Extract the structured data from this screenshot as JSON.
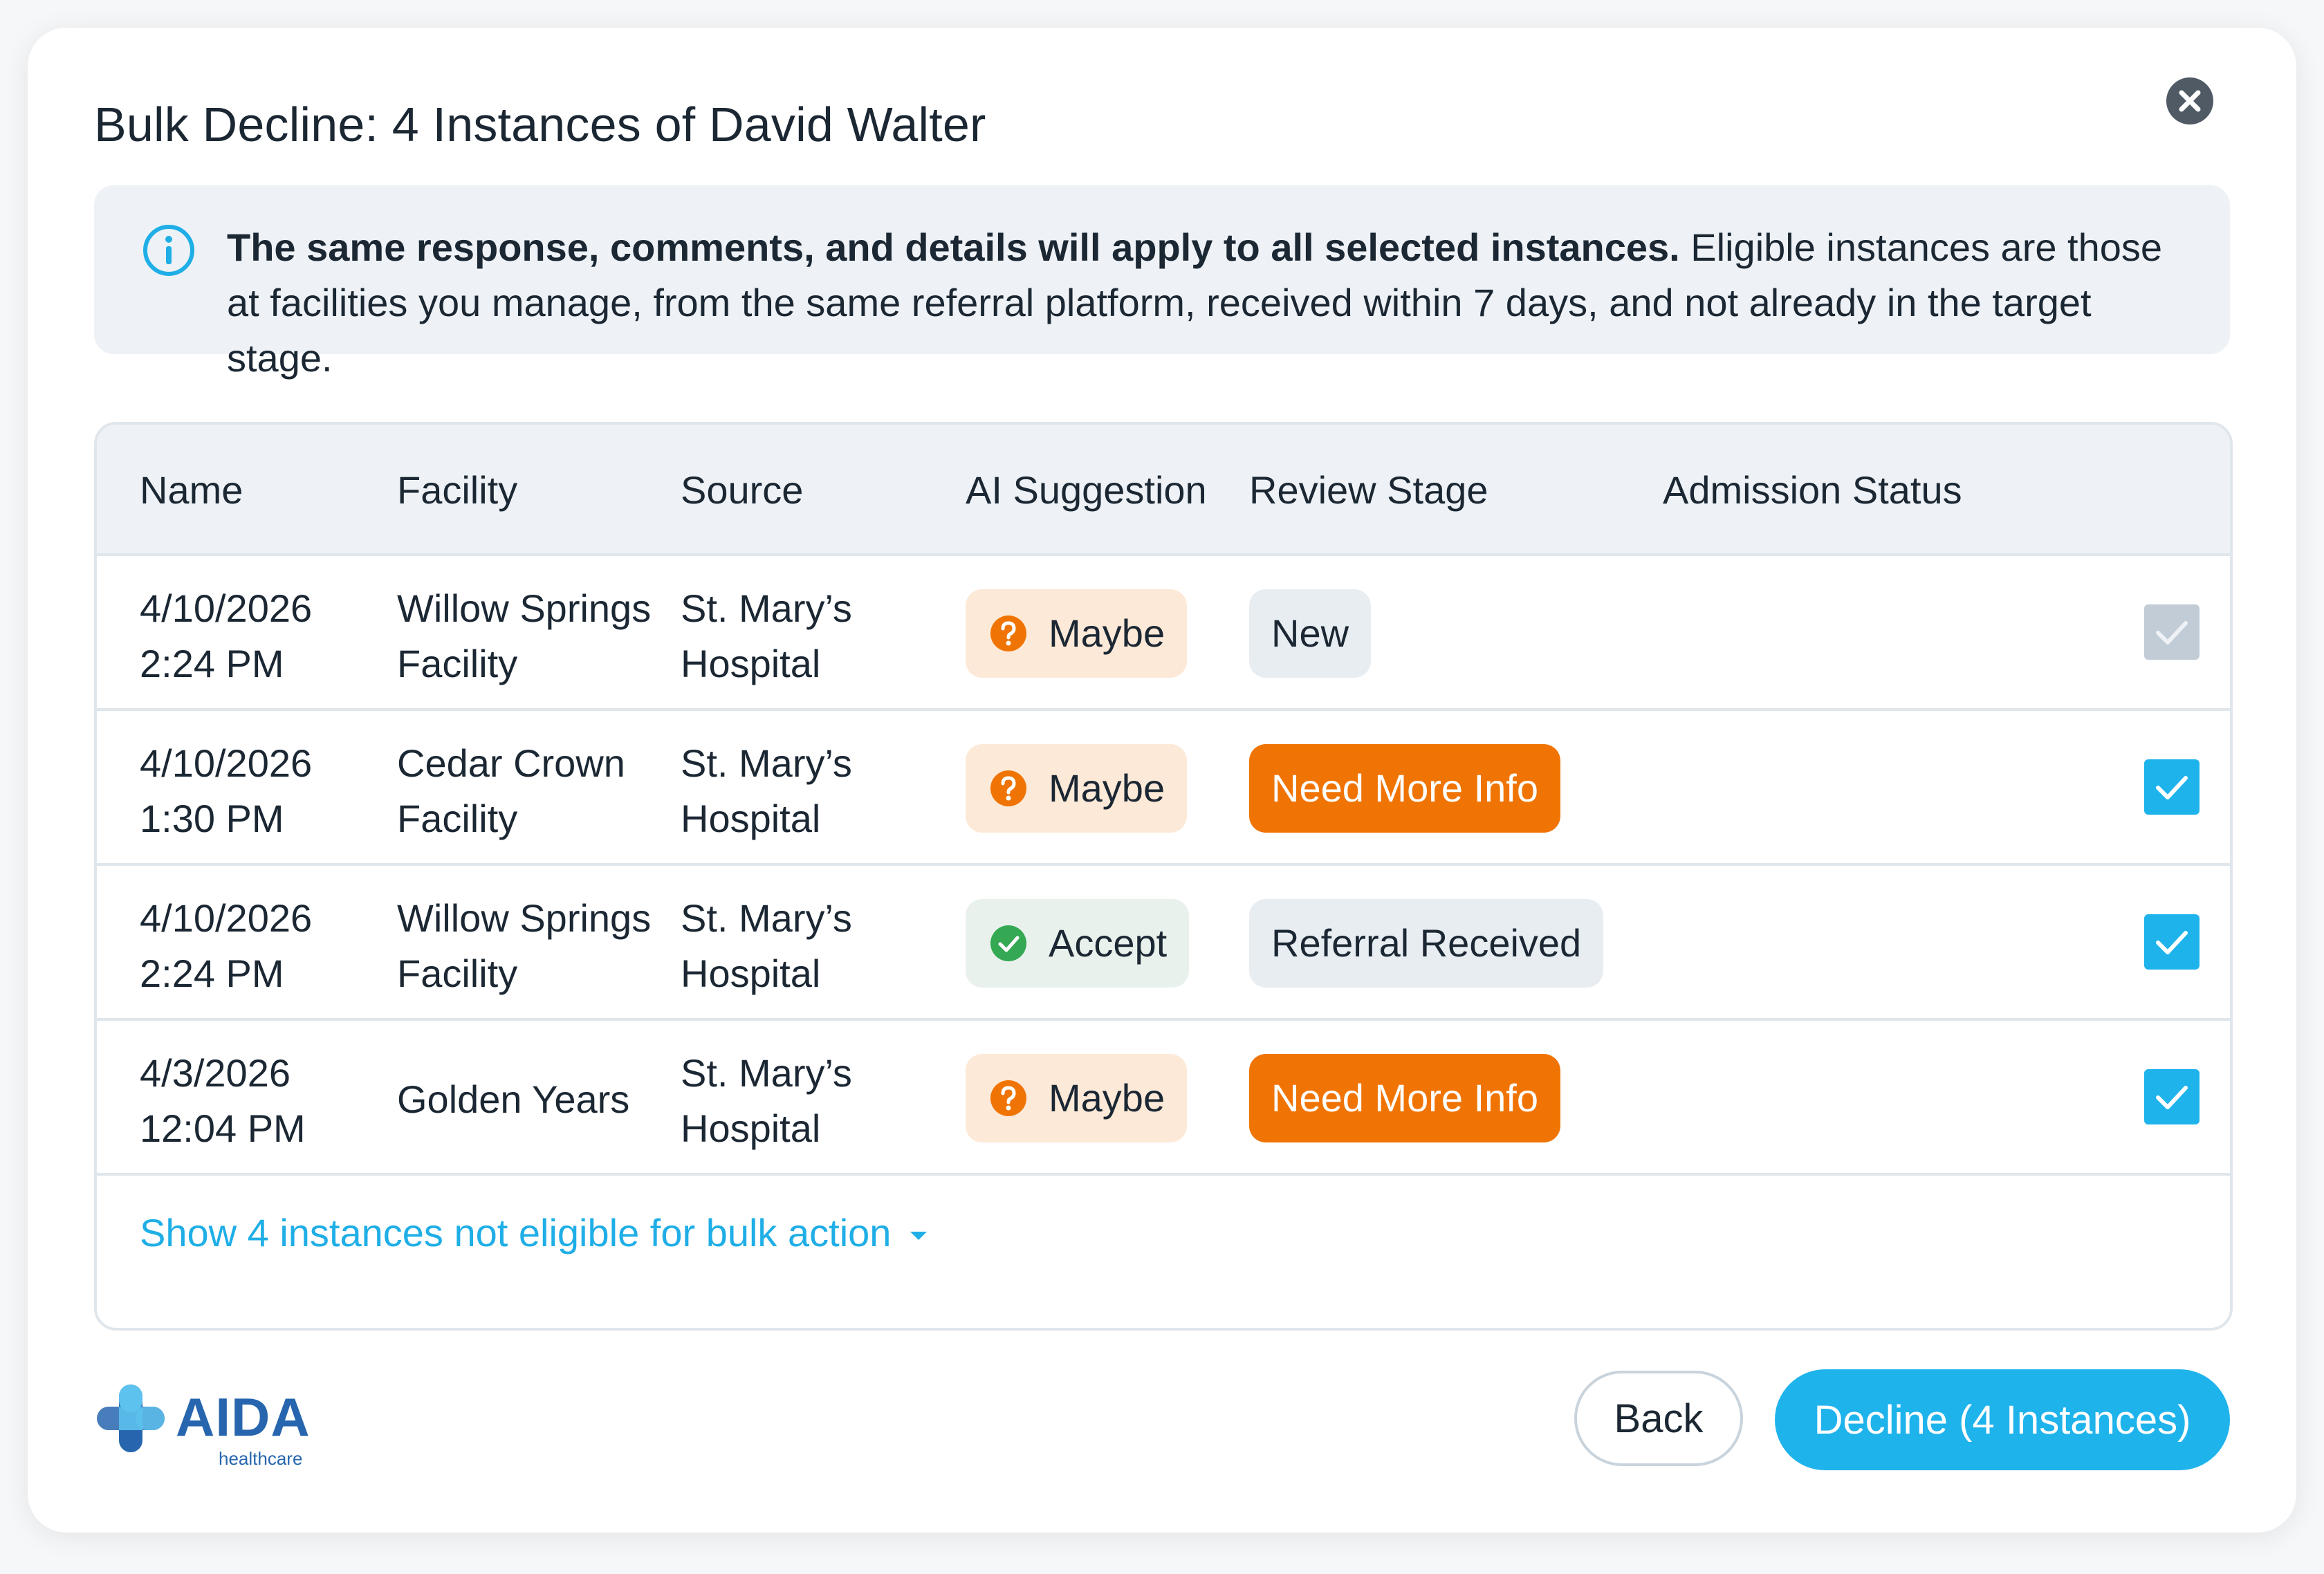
{
  "dialog": {
    "title": "Bulk Decline: 4 Instances of David Walter"
  },
  "info": {
    "bold_text": "The same response, comments, and details will apply to all selected instances.",
    "text": " Eligible instances are those at facilities you manage, from the same referral platform, received within 7 days, and not already in the target stage."
  },
  "table": {
    "headers": [
      "Name",
      "Facility",
      "Source",
      "AI Suggestion",
      "Review Stage",
      "Admission Status"
    ],
    "rows": [
      {
        "name_date": "4/10/2026",
        "name_time": "2:24 PM",
        "facility_line1": "Willow Springs",
        "facility_line2": "Facility",
        "source_line1": "St. Mary’s",
        "source_line2": "Hospital",
        "ai_suggestion": "Maybe",
        "ai_icon": "question-icon",
        "review_stage": "New",
        "checked": true,
        "disabled": true
      },
      {
        "name_date": "4/10/2026",
        "name_time": "1:30 PM",
        "facility_line1": "Cedar Crown",
        "facility_line2": "Facility",
        "source_line1": "St. Mary’s",
        "source_line2": "Hospital",
        "ai_suggestion": "Maybe",
        "ai_icon": "question-icon",
        "review_stage": "Need More Info",
        "checked": true,
        "disabled": false
      },
      {
        "name_date": "4/10/2026",
        "name_time": "2:24 PM",
        "facility_line1": "Willow Springs",
        "facility_line2": "Facility",
        "source_line1": "St. Mary’s",
        "source_line2": "Hospital",
        "ai_suggestion": "Accept",
        "ai_icon": "check-circle-icon",
        "review_stage": "Referral Received",
        "checked": true,
        "disabled": false
      },
      {
        "name_date": "4/3/2026",
        "name_time": "12:04 PM",
        "facility": "Golden Years",
        "source_line1": "St. Mary’s",
        "source_line2": "Hospital",
        "ai_suggestion": "Maybe",
        "ai_icon": "question-icon",
        "review_stage": "Need More Info",
        "checked": true,
        "disabled": false
      }
    ],
    "expand_link": "Show 4 instances not eligible for bulk action"
  },
  "logo": {
    "name": "AIDA",
    "sub": "healthcare"
  },
  "footer": {
    "back_label": "Back",
    "decline_label": "Decline (4 Instances)"
  },
  "colors": {
    "accent": "#1fb3ec",
    "need_more_info": "#f07404",
    "maybe_bg": "#fde9d7",
    "accept_bg": "#e9f1ec",
    "maybe_icon": "#f07404",
    "accept_icon": "#34a853"
  }
}
